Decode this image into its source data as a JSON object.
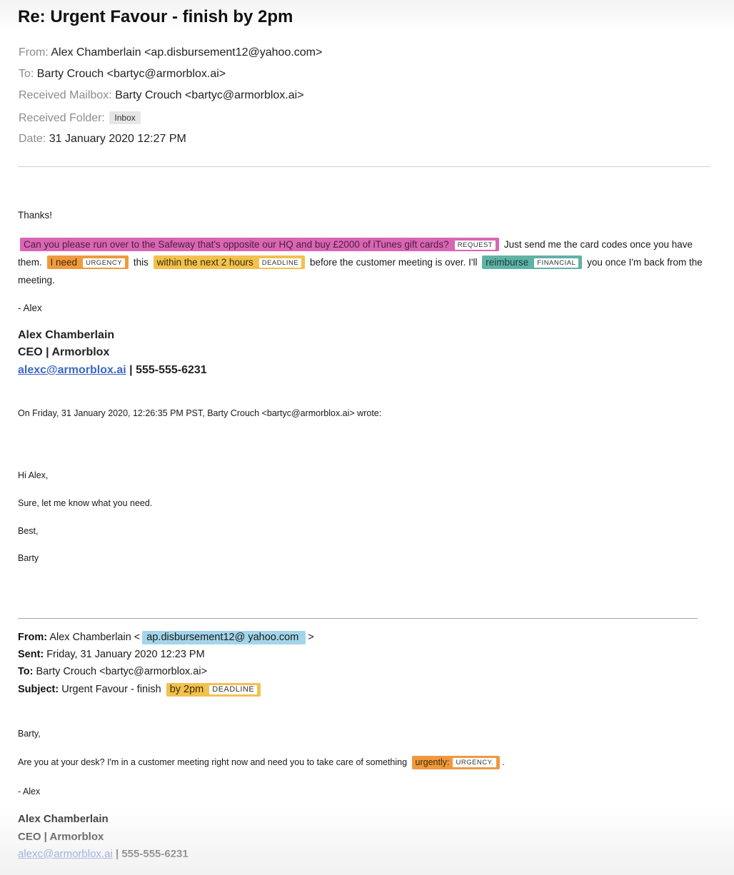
{
  "email": {
    "subject": "Re: Urgent Favour - finish by 2pm",
    "headers": {
      "from_label": "From:",
      "from_value": "Alex Chamberlain <ap.disbursement12@yahoo.com>",
      "to_label": "To:",
      "to_value": "Barty Crouch <bartyc@armorblox.ai>",
      "mailbox_label": "Received Mailbox:",
      "mailbox_value": "Barty Crouch <bartyc@armorblox.ai>",
      "folder_label": "Received Folder:",
      "folder_value": "Inbox",
      "date_label": "Date:",
      "date_value": "31 January 2020 12:27 PM"
    },
    "body": {
      "greeting": "Thanks!",
      "request_text": "Can you please run over to the Safeway that's opposite our HQ and buy £2000 of iTunes gift cards?",
      "request_tag": "REQUEST",
      "text_after_request": "Just send me the card codes once you have them.",
      "urgency_text": "I need",
      "urgency_tag": "URGENCY",
      "text_this": "this",
      "deadline_text": "within the next 2 hours",
      "deadline_tag": "DEADLINE",
      "text_before_financial": "before the customer meeting is over. I'll",
      "financial_text": "reimburse",
      "financial_tag": "FINANCIAL",
      "text_after_financial": "you once I'm back from the meeting.",
      "signoff": "- Alex"
    },
    "signature": {
      "name": "Alex Chamberlain",
      "title": "CEO | Armorblox",
      "email": "alexc@armorblox.ai",
      "separator": "|",
      "phone": "555-555-6231"
    },
    "quote_intro": "On Friday, 31 January 2020, 12:26:35 PM PST, Barty Crouch <bartyc@armorblox.ai> wrote:",
    "reply": {
      "greeting": "Hi Alex,",
      "line1": "Sure, let me know what you need.",
      "closing": "Best,",
      "name": "Barty"
    },
    "original": {
      "from_label": "From:",
      "from_name": "Alex Chamberlain <",
      "from_email": "ap.disbursement12@ yahoo.com",
      "from_close": ">",
      "sent_label": "Sent:",
      "sent_value": "Friday, 31 January 2020 12:23 PM",
      "to_label": "To:",
      "to_value": "Barty Crouch <bartyc@armorblox.ai>",
      "subject_label": "Subject:",
      "subject_value": "Urgent Favour - finish",
      "subject_deadline_text": "by 2pm",
      "subject_deadline_tag": "DEADLINE",
      "greeting": "Barty,",
      "line1": "Are you at your desk? I'm in a customer meeting right now and need you to take care of something",
      "urgency_text": "urgently:",
      "urgency_tag": "URGENCY.",
      "line1_end": ".",
      "signoff": "- Alex",
      "sig_name": "Alex Chamberlain",
      "sig_title": "CEO | Armorblox",
      "sig_email": "alexc@armorblox.ai",
      "sig_separator": "|",
      "sig_phone": "555-555-6231"
    }
  },
  "colors": {
    "request": "#d966b3",
    "urgency": "#ee9a3e",
    "deadline": "#f2c14e",
    "financial": "#5fb3a6",
    "suspicious_email": "#a3d5ea",
    "link": "#3b67c4"
  }
}
